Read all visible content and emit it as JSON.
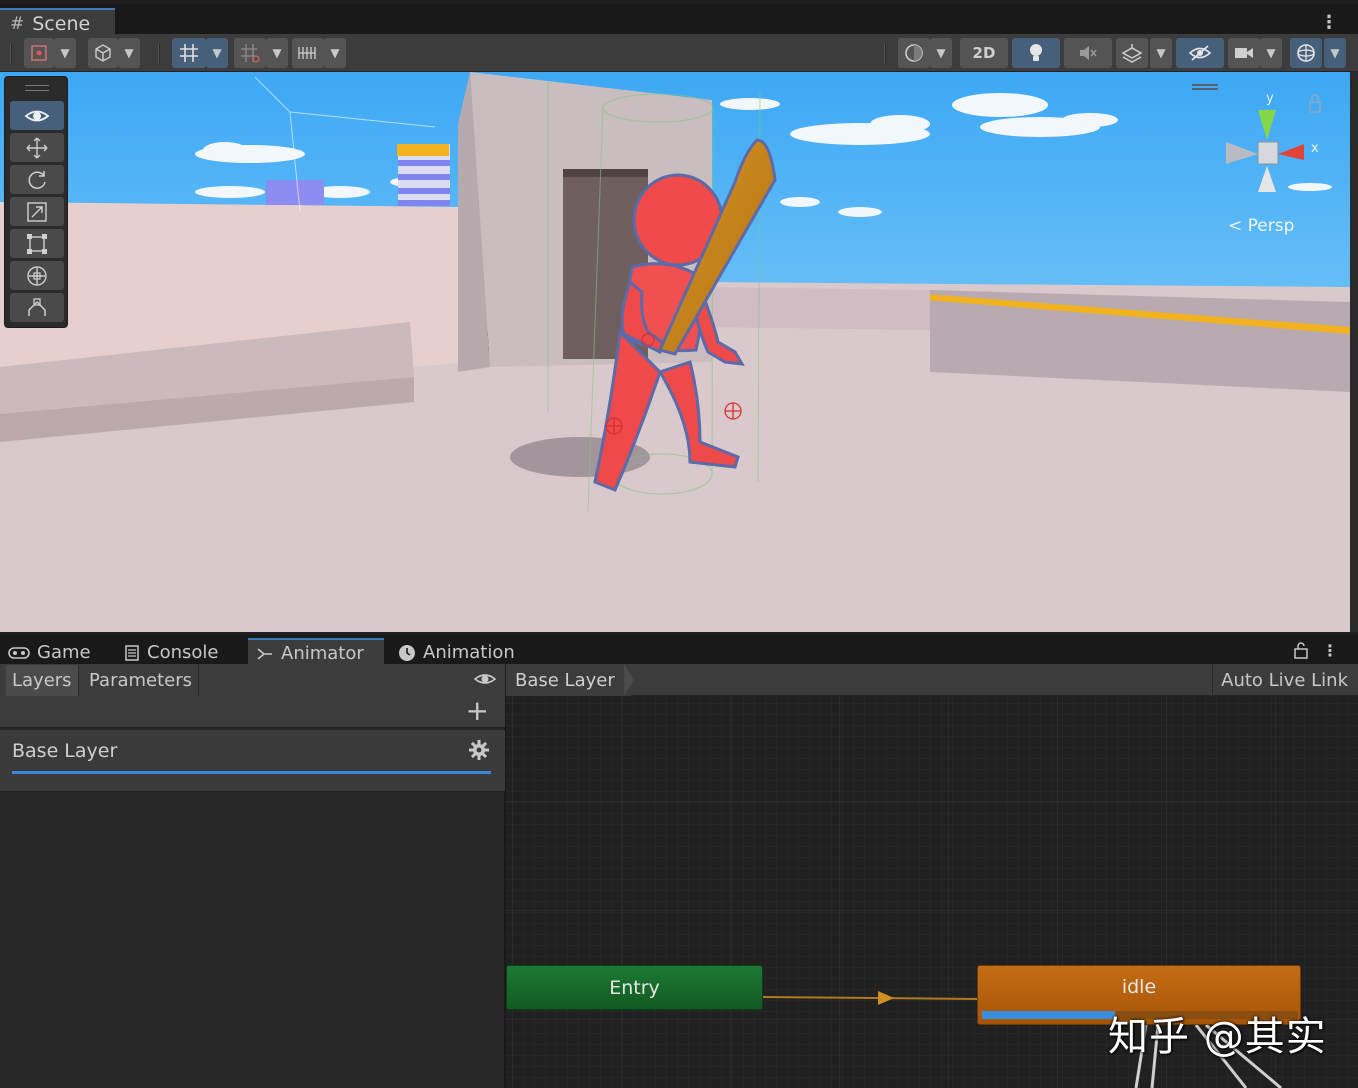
{
  "scene_window": {
    "tab_label": "Scene",
    "toolbar": {
      "btn_2d_label": "2D"
    },
    "persp_label": "Persp",
    "axis_x_label": "x",
    "axis_y_label": "y"
  },
  "bottom_tabs": [
    {
      "label": "Game",
      "icon": "gamepad-icon"
    },
    {
      "label": "Console",
      "icon": "console-icon"
    },
    {
      "label": "Animator",
      "icon": "animator-icon",
      "active": true
    },
    {
      "label": "Animation",
      "icon": "clock-icon"
    }
  ],
  "animator": {
    "left_tabs": [
      "Layers",
      "Parameters"
    ],
    "active_left_tab": "Layers",
    "layers": [
      {
        "name": "Base Layer"
      }
    ],
    "breadcrumb": "Base Layer",
    "auto_live_link": "Auto Live Link",
    "states": {
      "entry": "Entry",
      "idle": "idle",
      "idle_progress_fraction": 0.42
    }
  },
  "colors": {
    "accent_blue": "#3a86d8",
    "entry_green": "#1d7a33",
    "state_orange": "#c46c14",
    "transition_line": "#b07a1a"
  },
  "watermark": "知乎 @其实"
}
